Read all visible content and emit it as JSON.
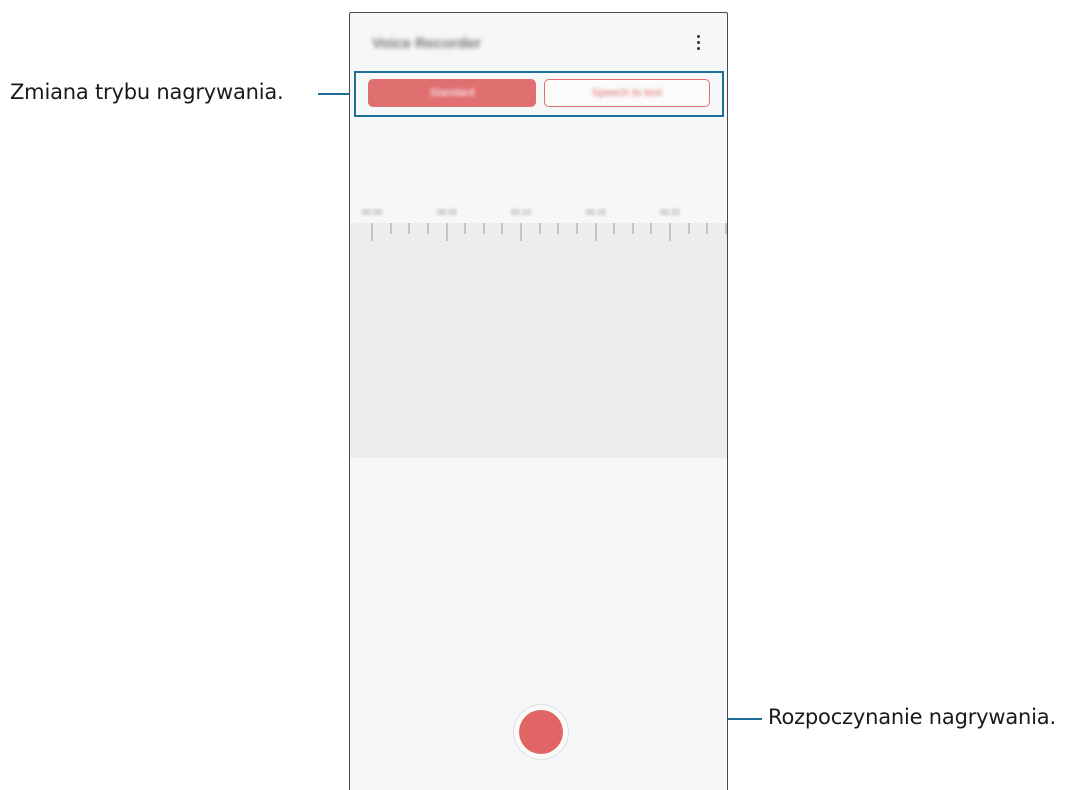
{
  "callouts": {
    "mode_change": "Zmiana trybu nagrywania.",
    "start_recording": "Rozpoczynanie nagrywania."
  },
  "app": {
    "title": "Voice Recorder",
    "menu_icon": "more-vert-icon"
  },
  "modes": {
    "standard_label": "Standard",
    "stt_label": "Speech to text",
    "selected": "Standard"
  },
  "timeline": {
    "time_labels": [
      "00:00",
      "00:05",
      "00:10",
      "00:15",
      "00:20"
    ]
  },
  "record_button": {
    "icon": "record-icon"
  },
  "colors": {
    "accent": "#e06f70",
    "callout_line": "#1d6f9a",
    "background": "#f5f7f8",
    "timeline_bg": "#ededed"
  }
}
